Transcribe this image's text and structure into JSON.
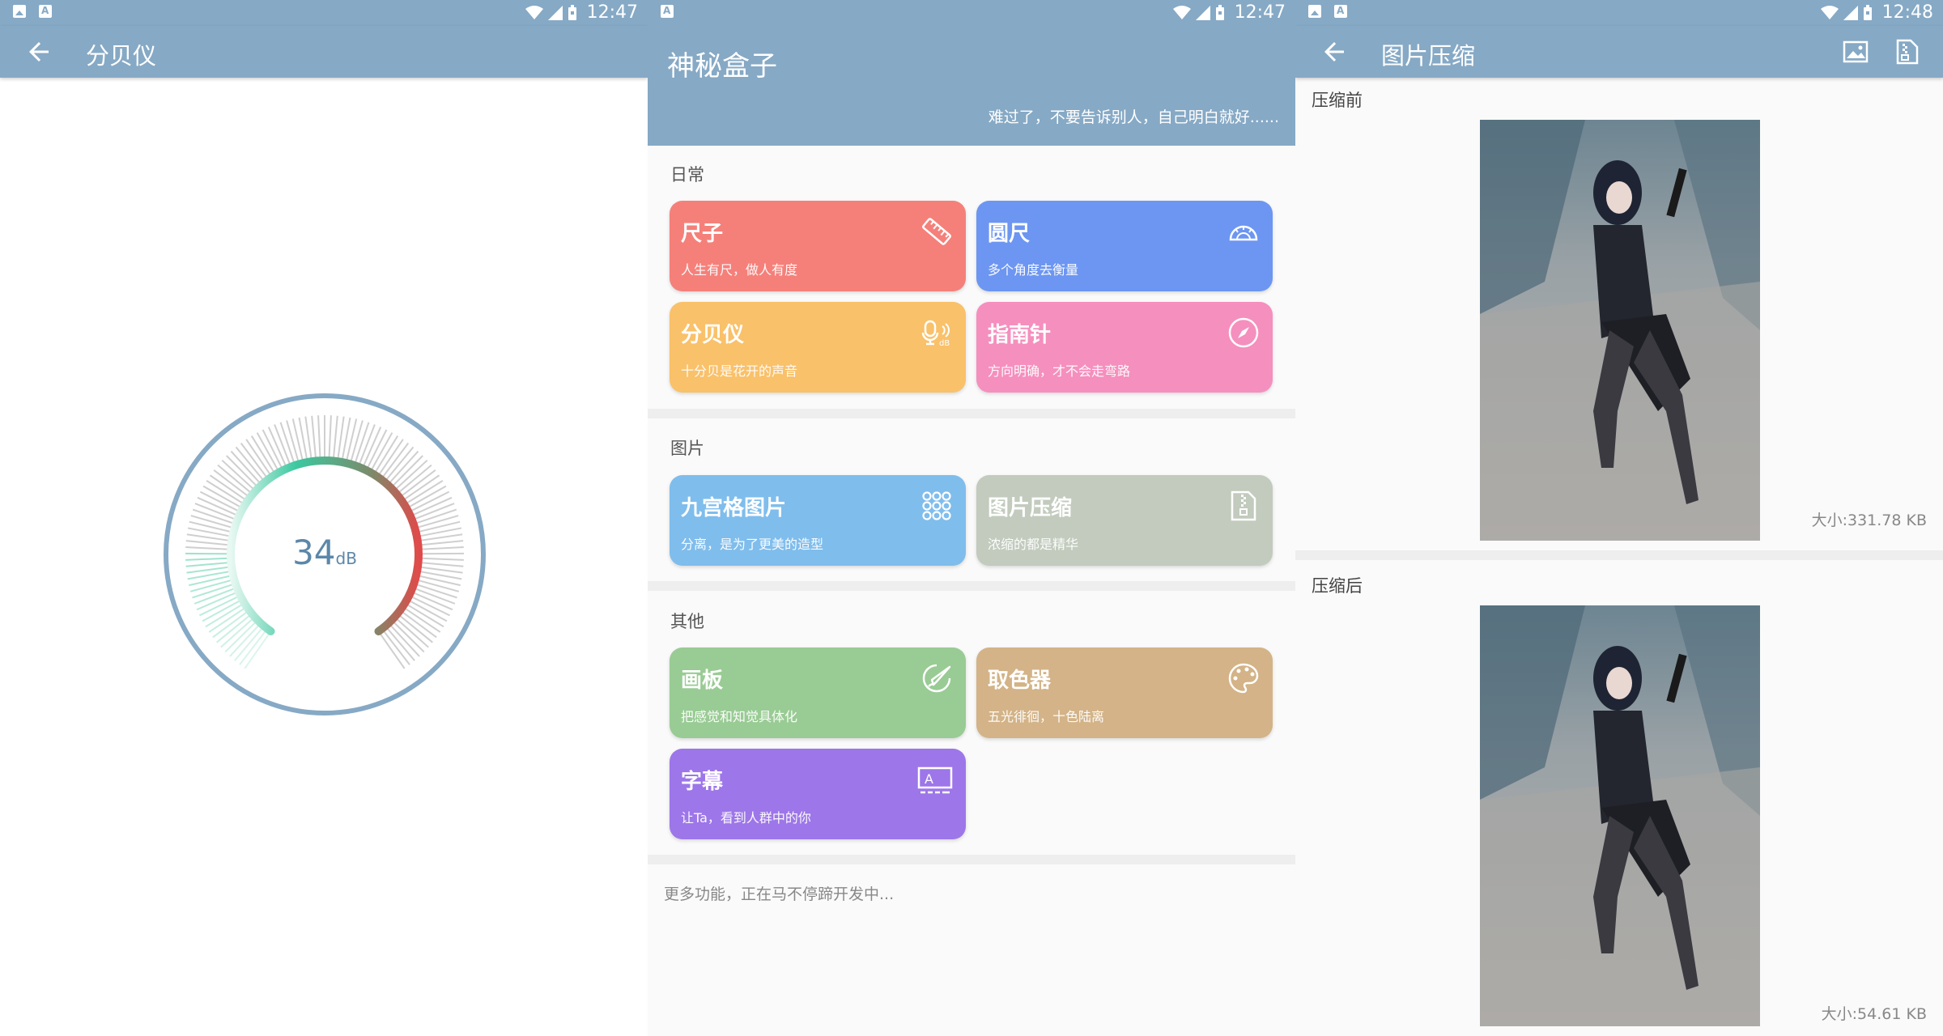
{
  "status": {
    "time_left": "12:47",
    "time_mid": "12:47",
    "time_right": "12:48"
  },
  "decibel": {
    "title": "分贝仪",
    "value": "34",
    "unit": "dB"
  },
  "home": {
    "title": "神秘盒子",
    "subtitle": "难过了，不要告诉别人，自己明白就好......",
    "sections": [
      {
        "title": "日常"
      },
      {
        "title": "图片"
      },
      {
        "title": "其他"
      }
    ],
    "cards": [
      {
        "title": "尺子",
        "desc": "人生有尺，做人有度",
        "color": "#f5807a",
        "icon": "ruler-icon"
      },
      {
        "title": "圆尺",
        "desc": "多个角度去衡量",
        "color": "#6c96f1",
        "icon": "protractor-icon"
      },
      {
        "title": "分贝仪",
        "desc": "十分贝是花开的声音",
        "color": "#f9c16a",
        "icon": "decibel-icon"
      },
      {
        "title": "指南针",
        "desc": "方向明确，才不会走弯路",
        "color": "#f58fbe",
        "icon": "compass-icon"
      },
      {
        "title": "九宫格图片",
        "desc": "分离，是为了更美的造型",
        "color": "#7fbdec",
        "icon": "grid-icon"
      },
      {
        "title": "图片压缩",
        "desc": "浓缩的都是精华",
        "color": "#c2cbbd",
        "icon": "zip-file-icon"
      },
      {
        "title": "画板",
        "desc": "把感觉和知觉具体化",
        "color": "#99cb94",
        "icon": "paint-icon"
      },
      {
        "title": "取色器",
        "desc": "五光徘徊，十色陆离",
        "color": "#d3b387",
        "icon": "palette-icon"
      },
      {
        "title": "字幕",
        "desc": "让Ta，看到人群中的你",
        "color": "#9d76e9",
        "icon": "subtitle-icon"
      }
    ],
    "more": "更多功能，正在马不停蹄开发中..."
  },
  "compress": {
    "title": "图片压缩",
    "before_label": "压缩前",
    "before_size": "大小:331.78 KB",
    "after_label": "压缩后",
    "after_size": "大小:54.61 KB"
  }
}
